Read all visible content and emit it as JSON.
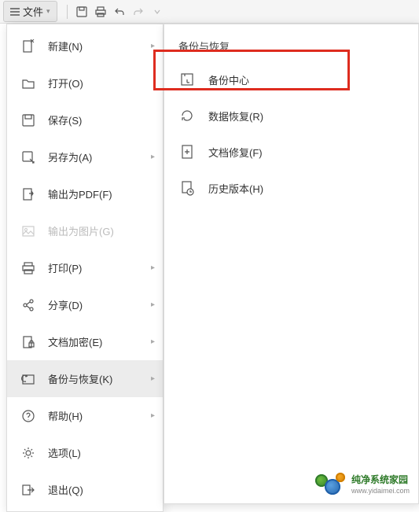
{
  "topbar": {
    "file_label": "文件"
  },
  "menu": {
    "items": [
      {
        "label": "新建(N)",
        "icon": "new",
        "arrow": true
      },
      {
        "label": "打开(O)",
        "icon": "open",
        "arrow": false
      },
      {
        "label": "保存(S)",
        "icon": "save",
        "arrow": false
      },
      {
        "label": "另存为(A)",
        "icon": "saveas",
        "arrow": true
      },
      {
        "label": "输出为PDF(F)",
        "icon": "pdf",
        "arrow": false
      },
      {
        "label": "输出为图片(G)",
        "icon": "image",
        "arrow": false,
        "disabled": true
      },
      {
        "label": "打印(P)",
        "icon": "print",
        "arrow": true
      },
      {
        "label": "分享(D)",
        "icon": "share",
        "arrow": true
      },
      {
        "label": "文档加密(E)",
        "icon": "encrypt",
        "arrow": true
      },
      {
        "label": "备份与恢复(K)",
        "icon": "backup",
        "arrow": true,
        "active": true
      },
      {
        "label": "帮助(H)",
        "icon": "help",
        "arrow": true
      },
      {
        "label": "选项(L)",
        "icon": "options",
        "arrow": false
      },
      {
        "label": "退出(Q)",
        "icon": "exit",
        "arrow": false
      }
    ]
  },
  "submenu": {
    "title": "备份与恢复",
    "items": [
      {
        "label": "备份中心",
        "icon": "backup-center",
        "highlighted": true
      },
      {
        "label": "数据恢复(R)",
        "icon": "data-recover"
      },
      {
        "label": "文档修复(F)",
        "icon": "doc-repair"
      },
      {
        "label": "历史版本(H)",
        "icon": "history"
      }
    ]
  },
  "watermark": {
    "title": "纯净系统家园",
    "url": "www.yidaimei.com"
  },
  "colors": {
    "highlight": "#de2c1f",
    "menu_active_bg": "#ececec"
  }
}
